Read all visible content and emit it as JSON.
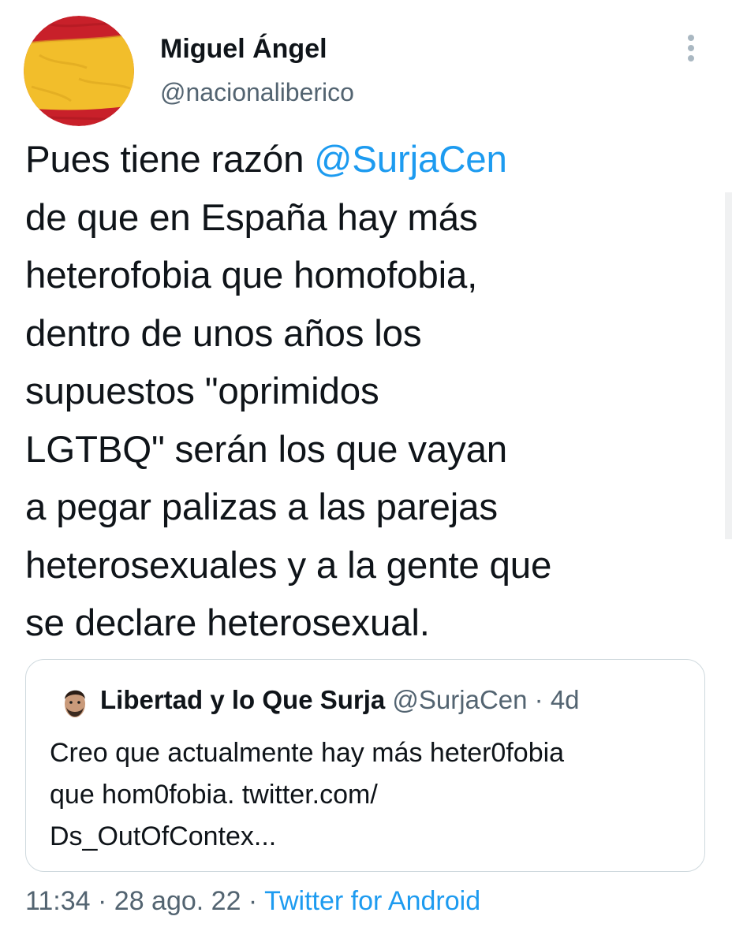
{
  "author": {
    "name": "Miguel Ángel",
    "handle": "@nacionaliberico",
    "avatar_icon": "spain-flag-avatar"
  },
  "more_icon": "vertical-ellipsis-icon",
  "tweet": {
    "line1_prefix": "Pues tiene razón ",
    "mention": "@SurjaCen",
    "lines": [
      "de que en España hay más",
      "heterofobia que homofobia,",
      "dentro de unos años los",
      "supuestos \"oprimidos",
      "LGTBQ\" serán los que vayan",
      "a pegar palizas a las parejas",
      "heterosexuales y a la gente que",
      "se declare heterosexual."
    ]
  },
  "quoted_tweet": {
    "name": "Libertad y lo Que Surja",
    "handle": "@SurjaCen",
    "separator": " · ",
    "age": "4d",
    "avatar_icon": "user-avatar",
    "lines": [
      "Creo que actualmente hay más heter0fobia",
      "que hom0fobia. twitter.com/",
      "Ds_OutOfContex..."
    ]
  },
  "footer": {
    "time": "11:34",
    "separator": " · ",
    "date": "28 ago. 22",
    "source": "Twitter for Android"
  },
  "colors": {
    "accent": "#1d9bf0",
    "text": "#0f1419",
    "secondary": "#536471",
    "border": "#cfd9de",
    "flag_red": "#c8202a",
    "flag_yellow": "#f2be2b"
  }
}
